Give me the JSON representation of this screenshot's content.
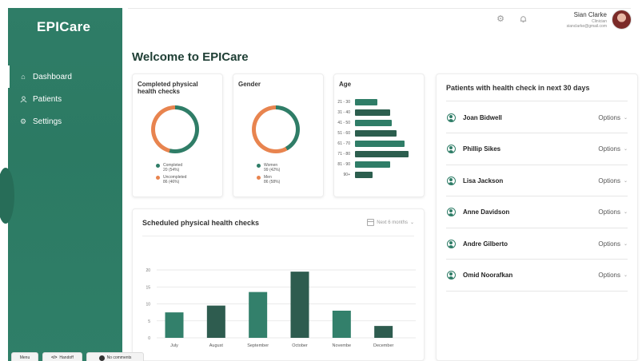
{
  "app": {
    "logo": "EPICare"
  },
  "sidebar": {
    "items": [
      {
        "label": "Dashboard",
        "icon": "home-icon",
        "active": true
      },
      {
        "label": "Patients",
        "icon": "users-icon",
        "active": false
      },
      {
        "label": "Settings",
        "icon": "gear-icon",
        "active": false
      }
    ]
  },
  "header": {
    "user_name": "Sian Clarke",
    "user_role": "Clinician",
    "user_email": "sianclarke@gmail.com"
  },
  "welcome": "Welcome to EPICare",
  "completed": {
    "title": "Completed physical health checks",
    "segments": [
      {
        "label": "Completed",
        "value": "20 (54%)",
        "percent": 54,
        "color": "#2f7d67"
      },
      {
        "label": "Uncompleted",
        "value": "86 (46%)",
        "percent": 46,
        "color": "#e8844f"
      }
    ]
  },
  "gender": {
    "title": "Gender",
    "segments": [
      {
        "label": "Women",
        "value": "99 (42%)",
        "percent": 42,
        "color": "#2f7d67"
      },
      {
        "label": "Men",
        "value": "86 (58%)",
        "percent": 58,
        "color": "#e8844f"
      }
    ]
  },
  "age": {
    "title": "Age",
    "groups": [
      {
        "label": "21 - 30",
        "value": 28,
        "color": "#2f7d67"
      },
      {
        "label": "31 - 40",
        "value": 44,
        "color": "#2c5e4e"
      },
      {
        "label": "41 - 50",
        "value": 46,
        "color": "#2f7d67"
      },
      {
        "label": "51 - 60",
        "value": 52,
        "color": "#2c5e4e"
      },
      {
        "label": "61 - 70",
        "value": 62,
        "color": "#2f7d67"
      },
      {
        "label": "71 - 80",
        "value": 67,
        "color": "#2c5e4e"
      },
      {
        "label": "81 - 90",
        "value": 44,
        "color": "#2f7d67"
      },
      {
        "label": "90+",
        "value": 22,
        "color": "#2c5e4e"
      }
    ]
  },
  "scheduled": {
    "title": "Scheduled physical health checks",
    "period": "Next 6 months"
  },
  "chart_data": {
    "type": "bar",
    "categories": [
      "July",
      "August",
      "September",
      "October",
      "Novembe",
      "December"
    ],
    "values": [
      7.5,
      9.5,
      13.5,
      19.5,
      8,
      3.5
    ],
    "colors": [
      "#33806b",
      "#2e5c4f",
      "#33806b",
      "#2e5c4f",
      "#33806b",
      "#2e5c4f"
    ],
    "yticks": [
      "0",
      "5",
      "10",
      "15",
      "20"
    ],
    "ylim": [
      0,
      20
    ],
    "grid": true
  },
  "upcoming": {
    "title": "Patients with health check in next 30 days",
    "option_label": "Options",
    "patients": [
      "Joan Bidwell",
      "Phillip Sikes",
      "Lisa Jackson",
      "Anne Davidson",
      "Andre Gilberto",
      "Omid Noorafkan"
    ]
  },
  "footer": {
    "menu": "Menu",
    "handoff": "Handoff",
    "comments": "No comments"
  }
}
